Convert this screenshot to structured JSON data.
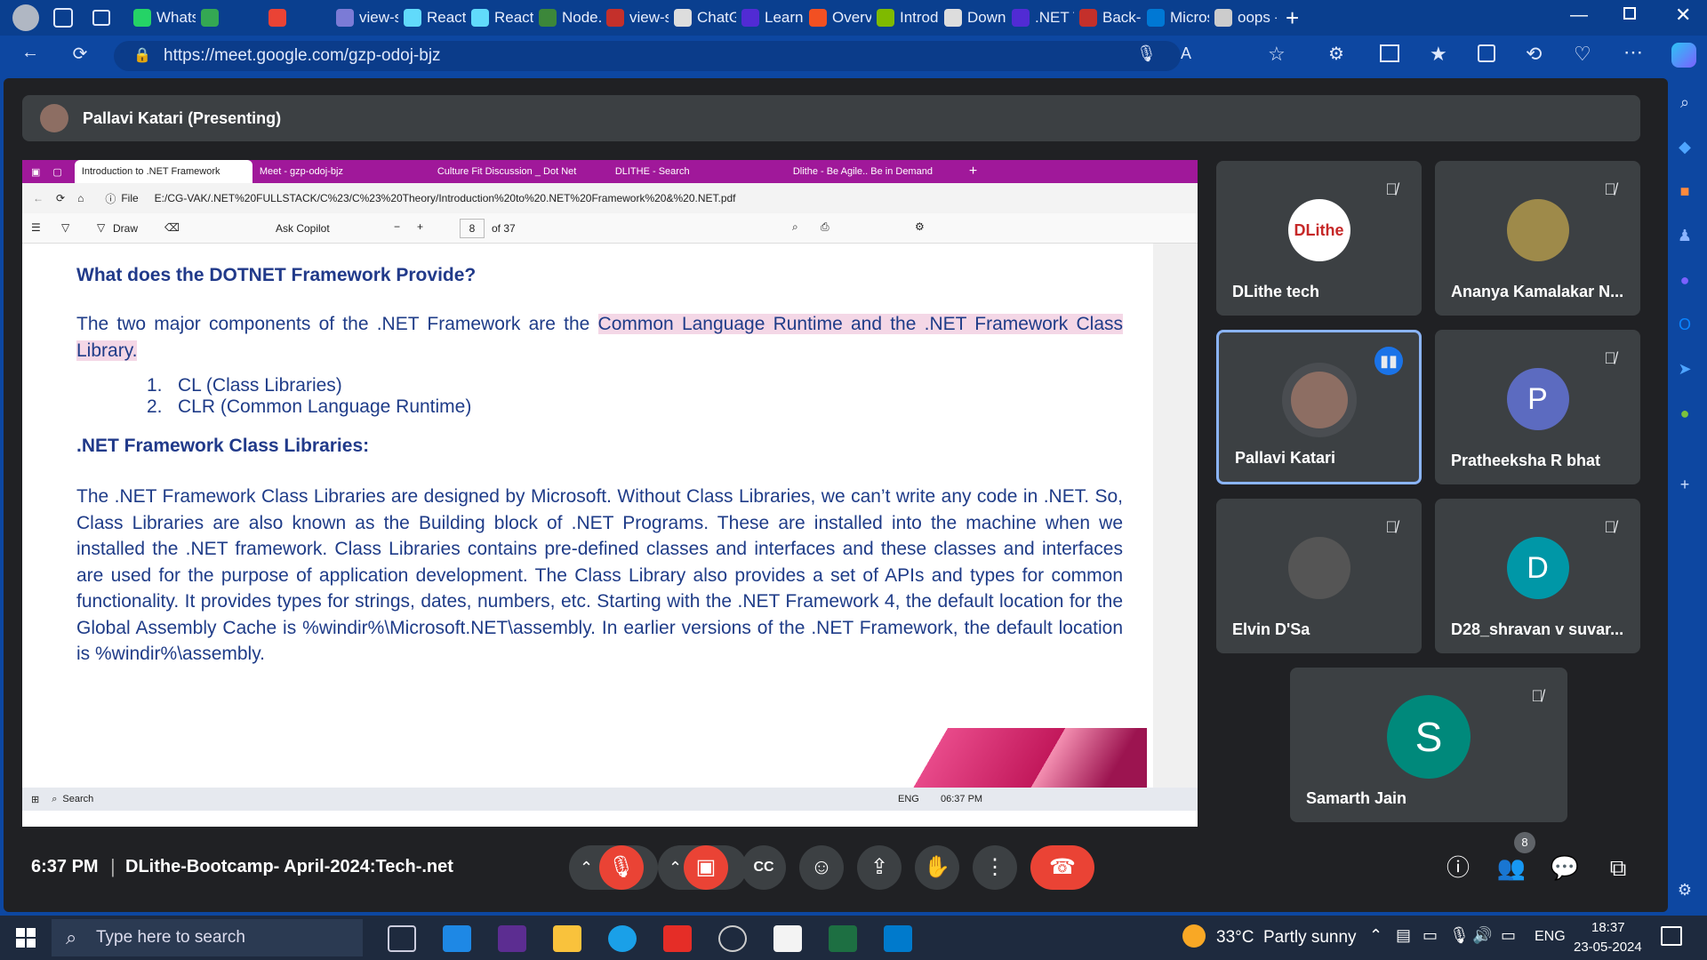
{
  "browser_tabs": [
    {
      "label": "WhatsA",
      "color": "#25d366"
    },
    {
      "label": "",
      "color": "#34a853"
    },
    {
      "label": "",
      "color": "#ea4335"
    },
    {
      "label": "view-so",
      "color": "#7b7bd6"
    },
    {
      "label": "React A",
      "color": "#61dafb"
    },
    {
      "label": "React",
      "color": "#61dafb"
    },
    {
      "label": "Node.js",
      "color": "#3c873a"
    },
    {
      "label": "view-so",
      "color": "#c4302b"
    },
    {
      "label": "ChatGP",
      "color": "#dddddd"
    },
    {
      "label": "Learn b",
      "color": "#512bd4"
    },
    {
      "label": "Overvie",
      "color": "#f25022"
    },
    {
      "label": "Introdu",
      "color": "#7fba00"
    },
    {
      "label": "Downlo",
      "color": "#dddddd"
    },
    {
      "label": ".NET Tu",
      "color": "#512bd4"
    },
    {
      "label": "Back-er",
      "color": "#c4302b"
    },
    {
      "label": "Microso",
      "color": "#0078d4"
    },
    {
      "label": "oops -",
      "color": "#cccccc"
    }
  ],
  "address": {
    "url": "https://meet.google.com/gzp-odoj-bjz"
  },
  "presenting": {
    "label": "Pallavi Katari (Presenting)"
  },
  "inner_tabs": [
    "Introduction to .NET Framework",
    "Meet - gzp-odoj-bjz",
    "Culture Fit Discussion _ Dot Net",
    "DLITHE - Search",
    "Dlithe - Be Agile.. Be in Demand"
  ],
  "inner_address": {
    "file": "File",
    "path": "E:/CG-VAK/.NET%20FULLSTACK/C%23/C%23%20Theory/Introduction%20to%20.NET%20Framework%20&%20.NET.pdf"
  },
  "inner_toolbar": {
    "draw": "Draw",
    "copilot": "Ask Copilot",
    "page": "8",
    "of": "of 37"
  },
  "pdf": {
    "heading1": "What does the DOTNET Framework Provide?",
    "para1_pre": "The two major components of the .NET Framework are the ",
    "para1_hl": "Common Language Runtime and the .NET Framework Class Library.",
    "list": [
      "1.   CL (Class Libraries)",
      "2.   CLR (Common Language Runtime)"
    ],
    "heading2": ".NET Framework Class Libraries:",
    "para2": "The .NET Framework Class Libraries are designed by Microsoft. Without Class Libraries, we can’t write any code in .NET. So, Class Libraries are also known as the Building block of .NET Programs. These are installed into the machine when we installed the .NET framework. Class Libraries contains pre-defined classes and interfaces and these classes and interfaces are used for the purpose of application development. The Class Library also provides a set of APIs and types for common functionality. It provides types for strings, dates, numbers, etc. Starting with the .NET Framework 4, the default location for the Global Assembly Cache is %windir%\\Microsoft.NET\\assembly. In earlier versions of the .NET Framework, the default location is %windir%\\assembly."
  },
  "inner_taskbar": {
    "search": "Search",
    "lang": "ENG",
    "time": "06:37 PM"
  },
  "participants": [
    {
      "name": "DLithe tech",
      "avatar": "DLithe",
      "color": "#ffffff"
    },
    {
      "name": "Ananya Kamalakar N...",
      "avatar": "",
      "color": "#9e8a4a"
    },
    {
      "name": "Pallavi Katari",
      "avatar": "",
      "color": "#8d6e63"
    },
    {
      "name": "Pratheeksha R bhat",
      "avatar": "P",
      "color": "#5c6bc0"
    },
    {
      "name": "Elvin D'Sa",
      "avatar": "",
      "color": "#444444"
    },
    {
      "name": "D28_shravan v suvar...",
      "avatar": "D",
      "color": "#0097a7"
    },
    {
      "name": "Samarth Jain",
      "avatar": "S",
      "color": "#00897b"
    }
  ],
  "meeting": {
    "time": "6:37 PM",
    "separator": "|",
    "title": "DLithe-Bootcamp- April-2024:Tech-.net",
    "people_count": "8"
  },
  "taskbar": {
    "search": "Type here to search",
    "weather": "33°C  Partly sunny",
    "lang": "ENG",
    "time": "18:37",
    "date": "23-05-2024"
  }
}
